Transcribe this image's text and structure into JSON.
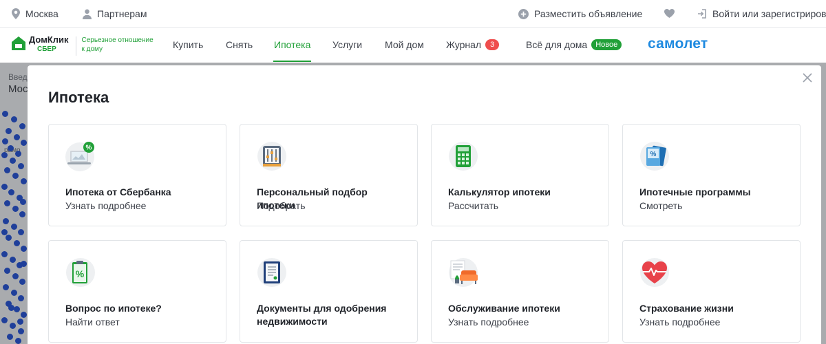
{
  "topbar": {
    "city": "Москва",
    "partners": "Партнерам",
    "post_ad": "Разместить объявление",
    "login": "Войти или зарегистрироваться"
  },
  "logo": {
    "name": "ДомКлик",
    "sber": "СБЕР",
    "slogan_line1": "Серьезное отношение",
    "slogan_line2": "к дому"
  },
  "nav": {
    "items": [
      {
        "label": "Купить"
      },
      {
        "label": "Снять"
      },
      {
        "label": "Ипотека",
        "active": true
      },
      {
        "label": "Услуги"
      },
      {
        "label": "Мой дом"
      },
      {
        "label": "Журнал",
        "badge": "3"
      },
      {
        "label": "Всё для дома",
        "badge": "Новое"
      }
    ],
    "partner_brand": "самолет"
  },
  "backdrop": {
    "search_label": "Введ",
    "search_value": "Мос",
    "map_text": "рамо"
  },
  "modal": {
    "title": "Ипотека",
    "cards": [
      {
        "title": "Ипотека от Сбербанка",
        "subtitle": "Узнать подробнее",
        "icon": "laptop-percent-icon"
      },
      {
        "title": "Персональный подбор ипотеки",
        "subtitle": "Подобрать",
        "icon": "sliders-icon"
      },
      {
        "title": "Калькулятор ипотеки",
        "subtitle": "Рассчитать",
        "icon": "calculator-icon"
      },
      {
        "title": "Ипотечные программы",
        "subtitle": "Смотреть",
        "icon": "percent-cards-icon"
      },
      {
        "title": "Вопрос по ипотеке?",
        "subtitle": "Найти ответ",
        "icon": "clipboard-percent-icon"
      },
      {
        "title_line1": "Документы для одобрения",
        "title_line2": "недвижимости",
        "icon": "document-icon"
      },
      {
        "title": "Обслуживание ипотеки",
        "subtitle": "Узнать подробнее",
        "icon": "armchair-icon"
      },
      {
        "title": "Страхование жизни",
        "subtitle": "Узнать подробнее",
        "icon": "heart-pulse-icon"
      }
    ]
  },
  "colors": {
    "accent": "#21a038",
    "badge_red": "#ef4d4d",
    "brand_blue": "#1f8ae0"
  }
}
